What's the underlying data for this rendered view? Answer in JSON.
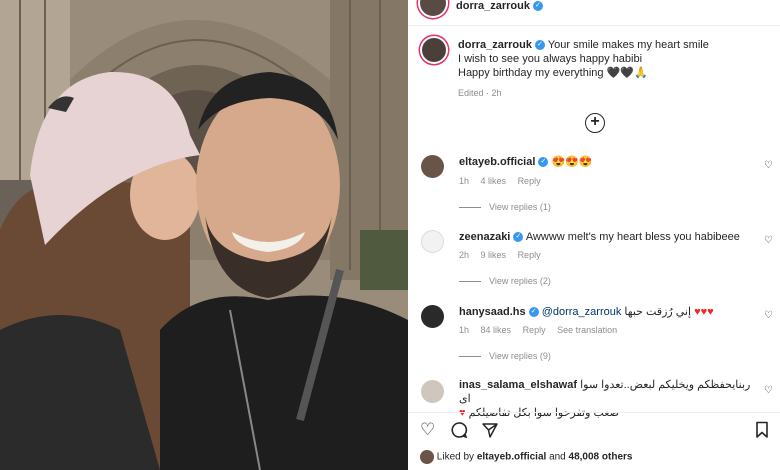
{
  "header": {
    "username": "dorra_zarrouk"
  },
  "caption": {
    "username": "dorra_zarrouk",
    "line1": "Your smile makes my heart smile",
    "line2": "I wish to see you always happy habibi",
    "line3": "Happy birthday my everything 🖤🖤🙏",
    "meta": "Edited · 2h"
  },
  "comments": [
    {
      "username": "eltayeb.official",
      "text": "😍😍😍",
      "time": "1h",
      "likes": "4 likes",
      "reply": "Reply",
      "view_replies": "View replies (1)"
    },
    {
      "username": "zeenazaki",
      "text": "Awwww melt's my heart bless you habibeee",
      "time": "2h",
      "likes": "9 likes",
      "reply": "Reply",
      "view_replies": "View replies (2)"
    },
    {
      "username": "hanysaad.hs",
      "mention": "@dorra_zarrouk",
      "text": "إني رُزقت حبها",
      "hearts": "♥♥♥",
      "time": "1h",
      "likes": "84 likes",
      "reply": "Reply",
      "translate": "See translation",
      "view_replies": "View replies (9)"
    },
    {
      "username": "inas_salama_elshawaf",
      "text": "ربنايحفظكم ويخليكم لبعض..تعدوا سوا اى",
      "text2": "صعب وتفرحوا سوا بكل تفاصيلكم",
      "heart2": "♥"
    }
  ],
  "footer": {
    "liked_by_prefix": "Liked by",
    "liked_by_user": "eltayeb.official",
    "liked_by_suffix": "and",
    "others": "48,008 others"
  },
  "icons": {
    "like": "heart-icon",
    "comment": "comment-icon",
    "share": "share-icon",
    "save": "bookmark-icon",
    "add": "plus-circle-icon"
  },
  "colors": {
    "verified": "#3897f0",
    "heart": "#ed2a2a",
    "story_ring": "#e1306c"
  }
}
